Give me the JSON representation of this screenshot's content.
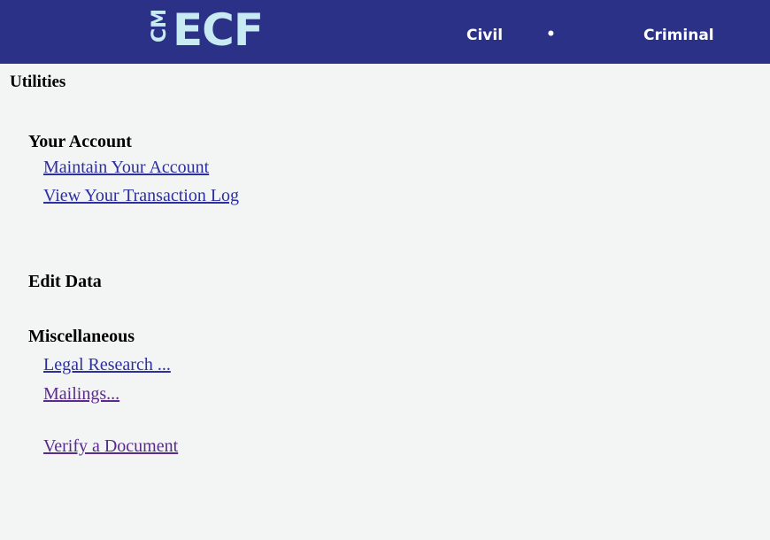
{
  "header": {
    "logo_cm": "CM",
    "logo_ecf": "ECF",
    "nav": {
      "civil": "Civil",
      "separator": "•",
      "criminal": "Criminal"
    }
  },
  "page": {
    "title": "Utilities"
  },
  "sections": {
    "your_account": {
      "heading": "Your Account",
      "links": {
        "maintain": "Maintain Your Account",
        "transaction_log": "View Your Transaction Log"
      }
    },
    "edit_data": {
      "heading": "Edit Data"
    },
    "miscellaneous": {
      "heading": "Miscellaneous",
      "links": {
        "legal_research": "Legal Research ...",
        "mailings": "Mailings...",
        "verify_document": "Verify a Document"
      }
    }
  },
  "colors": {
    "header_bg": "#2b3187",
    "logo": "#c7eaf3",
    "link": "#2d2fa0",
    "visited_link": "#5a2a8c",
    "page_bg": "#f3f5f5"
  }
}
